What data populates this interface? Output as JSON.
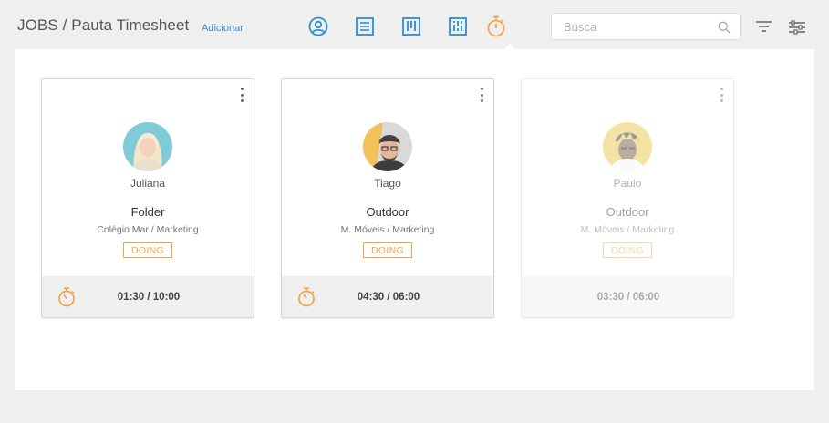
{
  "header": {
    "title": "JOBS / Pauta Timesheet",
    "add_label": "Adicionar",
    "nav_icons": [
      "user-circle-icon",
      "list-icon",
      "columns-icon",
      "board-icon",
      "timer-icon"
    ],
    "active_nav": "timer-icon",
    "search_placeholder": "Busca",
    "search_value": ""
  },
  "colors": {
    "accent_blue": "#2b8fd0",
    "accent_orange": "#f0a547",
    "background": "#efefef"
  },
  "cards": [
    {
      "person": "Juliana",
      "job": "Folder",
      "client": "Colégio Mar / Marketing",
      "status": "DOING",
      "time": "01:30 / 10:00",
      "active": true
    },
    {
      "person": "Tiago",
      "job": "Outdoor",
      "client": "M. Móveis / Marketing",
      "status": "DOING",
      "time": "04:30 / 06:00",
      "active": true
    },
    {
      "person": "Paulo",
      "job": "Outdoor",
      "client": "M. Móveis / Marketing",
      "status": "DOING",
      "time": "03:30 / 06:00",
      "active": false
    }
  ]
}
